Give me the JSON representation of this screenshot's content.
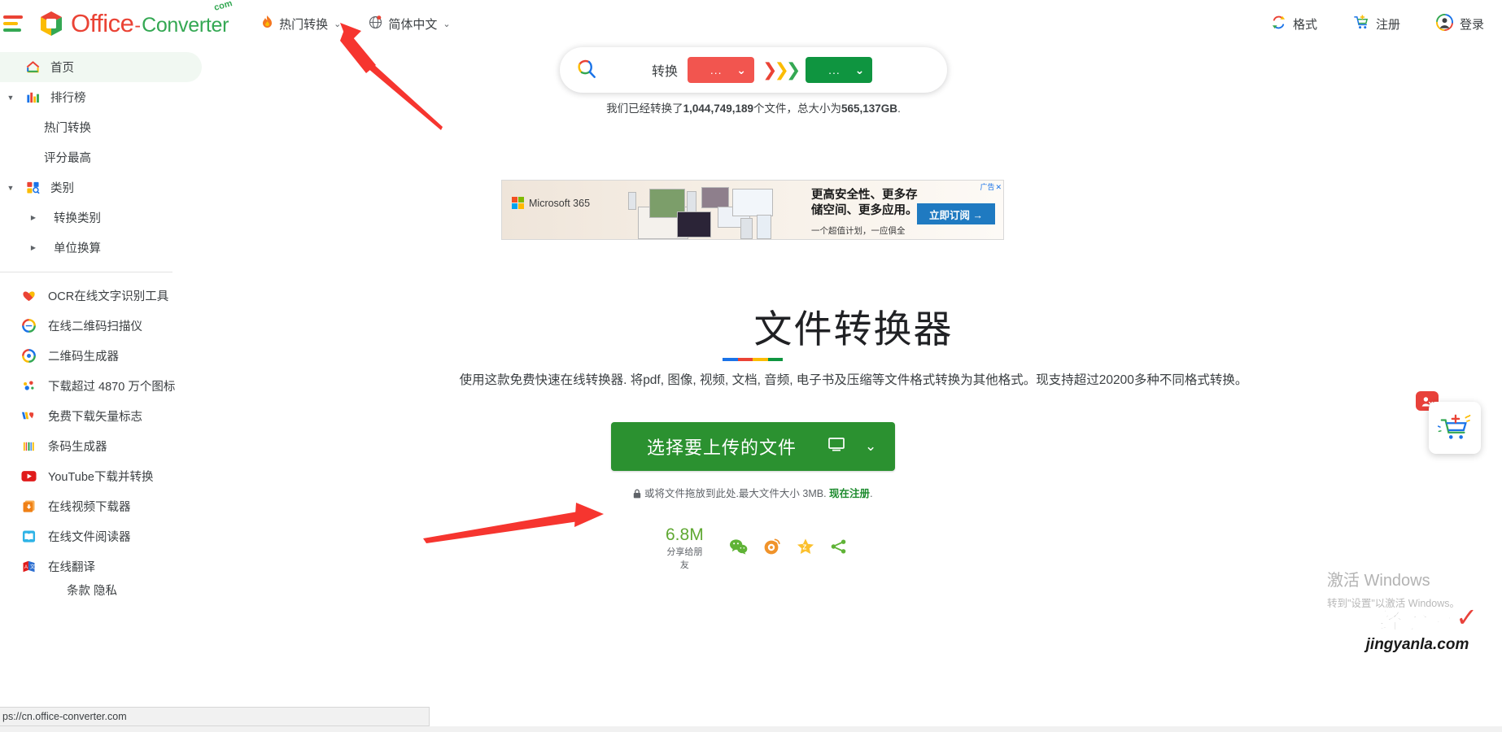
{
  "header": {
    "hamburger_icon": "menu-icon",
    "brand": {
      "office": "Office",
      "dash": "-",
      "converter": "Converter",
      "com": "com"
    },
    "menu": [
      {
        "label": "热门转换",
        "icon": "flame-icon",
        "chevron": "⌄"
      },
      {
        "label": "简体中文",
        "icon": "globe-icon",
        "chevron": "⌄"
      }
    ],
    "right": [
      {
        "label": "格式",
        "icon": "convert-arrows-icon"
      },
      {
        "label": "注册",
        "icon": "cart-plus-icon"
      },
      {
        "label": "登录",
        "icon": "avatar-icon"
      }
    ]
  },
  "sidebar": {
    "home": {
      "label": "首页",
      "icon": "home-icon"
    },
    "ranking": {
      "label": "排行榜",
      "icon": "bar-chart-icon",
      "expanded": true,
      "children": [
        {
          "label": "热门转换"
        },
        {
          "label": "评分最高"
        }
      ]
    },
    "category": {
      "label": "类别",
      "icon": "category-search-icon",
      "expanded": true,
      "children": [
        {
          "label": "转换类别"
        },
        {
          "label": "单位换算"
        }
      ]
    },
    "tools": [
      {
        "label": "OCR在线文字识别工具",
        "icon": "heart-icon"
      },
      {
        "label": "在线二维码扫描仪",
        "icon": "qr-scan-icon"
      },
      {
        "label": "二维码生成器",
        "icon": "qr-generate-icon"
      },
      {
        "label": "下载超过 4870 万个图标",
        "icon": "icons-dots-icon"
      },
      {
        "label": "免费下载矢量标志",
        "icon": "vector-logo-icon"
      },
      {
        "label": "条码生成器",
        "icon": "barcode-icon"
      },
      {
        "label": "YouTube下载并转换",
        "icon": "youtube-icon"
      },
      {
        "label": "在线视频下载器",
        "icon": "video-download-icon"
      },
      {
        "label": "在线文件阅读器",
        "icon": "file-reader-icon"
      },
      {
        "label": "在线翻译",
        "icon": "translate-icon"
      }
    ],
    "footer_cut": "条款   隐私"
  },
  "search": {
    "search_icon": "search-icon",
    "convert_label": "转换",
    "from_value": "...",
    "to_value": "...",
    "chevron": "⌄",
    "transfer_icon": "double-chevron-icon"
  },
  "stats": {
    "prefix": "我们已经转换了",
    "files": "1,044,749,189",
    "middle": "个文件，总大小为",
    "size": "565,137GB",
    "suffix": "."
  },
  "ad": {
    "badge": "广告",
    "close": "✕",
    "brand": "Microsoft 365",
    "headline_line1": "更高安全性、更多存",
    "headline_line2": "储空间、更多应用。",
    "subline": "一个超值计划，一应俱全",
    "cta": "立即订阅 →"
  },
  "hero": {
    "title": "文件转换器",
    "description": "使用这款免费快速在线转换器. 将pdf, 图像, 视频, 文档, 音频, 电子书及压缩等文件格式转换为其他格式。现支持超过20200多种不同格式转换。"
  },
  "upload": {
    "button_label": "选择要上传的文件",
    "device_icon": "monitor-icon",
    "chevron": "⌄",
    "note_lock_icon": "lock-icon",
    "note_prefix": "或将文件拖放到此处.最大文件大小 3MB.",
    "note_link": "现在注册",
    "note_suffix": "."
  },
  "share": {
    "count": "6.8M",
    "caption": "分享给朋友",
    "icons": [
      {
        "name": "wechat-icon",
        "color": "#5fb336"
      },
      {
        "name": "weibo-icon",
        "color": "#f0932b"
      },
      {
        "name": "qzone-icon",
        "color": "#fbc02d"
      },
      {
        "name": "share-more-icon",
        "color": "#5fb336"
      }
    ]
  },
  "fab": {
    "icon": "cart-sparkle-icon",
    "badge_icon": "user-close-icon"
  },
  "windows_activation": {
    "line1": "激活 Windows",
    "line2": "转到\"设置\"以激活 Windows。"
  },
  "watermark": {
    "cn": "经验啦",
    "en": "jingyanla.com",
    "tick": "✓"
  },
  "statusbar": {
    "url": "ps://cn.office-converter.com"
  },
  "colors": {
    "brand_red": "#ea4335",
    "brand_green": "#34a853",
    "brand_blue": "#1a73e8",
    "brand_yellow": "#fbbc04",
    "upload_green": "#2b9130",
    "pill_red": "#f2554f",
    "pill_green": "#0f9540",
    "sidebar_active": "#f1f8f2",
    "ad_cta_blue": "#1f7ac1",
    "arrow_red": "#f6352f"
  }
}
